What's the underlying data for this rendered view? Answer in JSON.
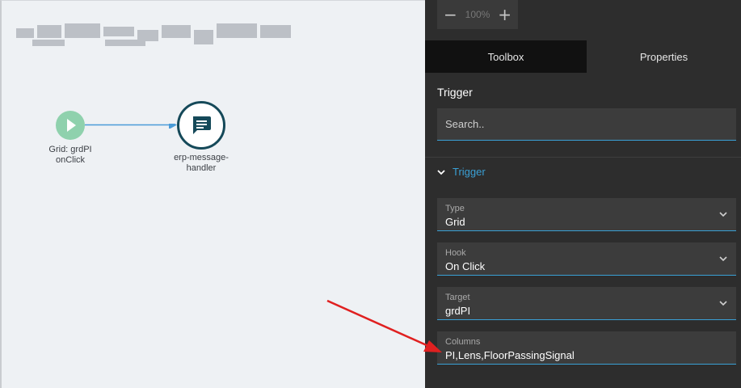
{
  "canvas": {
    "trigger_node": {
      "line1": "Grid: grdPI",
      "line2": "onClick",
      "icon": "play-icon",
      "color": "#8fd1ad"
    },
    "handler_node": {
      "line1": "erp-message-",
      "line2": "handler",
      "icon": "message-icon",
      "color": "#154959"
    }
  },
  "toolbar": {
    "zoom_out": "−",
    "zoom_level": "100%",
    "zoom_in": "+"
  },
  "tabs": [
    {
      "label": "Toolbox"
    },
    {
      "label": "Properties"
    }
  ],
  "panel": {
    "section_title": "Trigger",
    "search_placeholder": "Search..",
    "collapsible_label": "Trigger",
    "fields": [
      {
        "label": "Type",
        "value": "Grid"
      },
      {
        "label": "Hook",
        "value": "On Click"
      },
      {
        "label": "Target",
        "value": "grdPI"
      },
      {
        "label": "Columns",
        "value": "PI,Lens,FloorPassingSignal"
      }
    ]
  },
  "colors": {
    "accent": "#3aa0d5",
    "panel_bg": "#2d2d2d",
    "annotation_arrow": "#e02020"
  }
}
